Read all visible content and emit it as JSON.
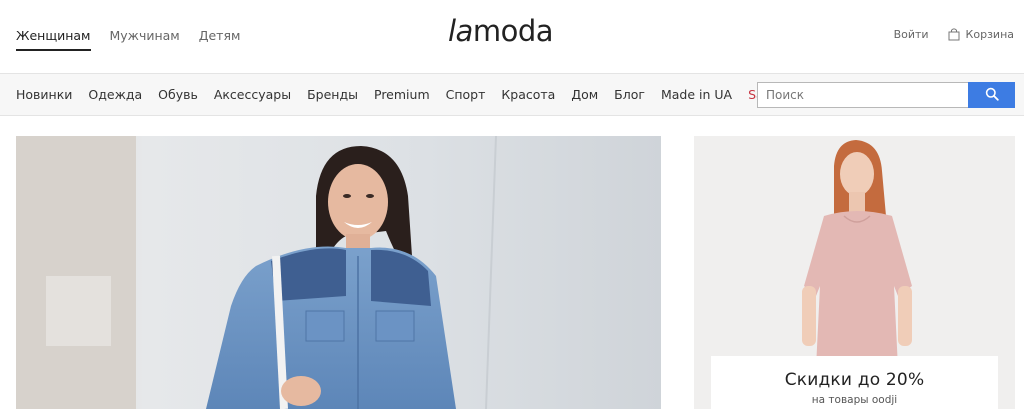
{
  "header": {
    "gender_tabs": [
      {
        "label": "Женщинам",
        "active": true
      },
      {
        "label": "Мужчинам",
        "active": false
      },
      {
        "label": "Детям",
        "active": false
      }
    ],
    "logo": {
      "part1": "la",
      "part2": "moda"
    },
    "login_label": "Войти",
    "cart_label": "Корзина",
    "cart_icon": "shopping-bag-icon"
  },
  "categories": {
    "items": [
      "Новинки",
      "Одежда",
      "Обувь",
      "Аксессуары",
      "Бренды",
      "Premium",
      "Спорт",
      "Красота",
      "Дом",
      "Блог",
      "Made in UA",
      "Sale%"
    ],
    "sale_color": "#c73643"
  },
  "search": {
    "placeholder": "Поиск",
    "value": "",
    "button_icon": "search-icon",
    "button_color": "#3d7ce3"
  },
  "side_banner": {
    "title": "Скидки до 20%",
    "subtitle": "на товары oodji"
  }
}
